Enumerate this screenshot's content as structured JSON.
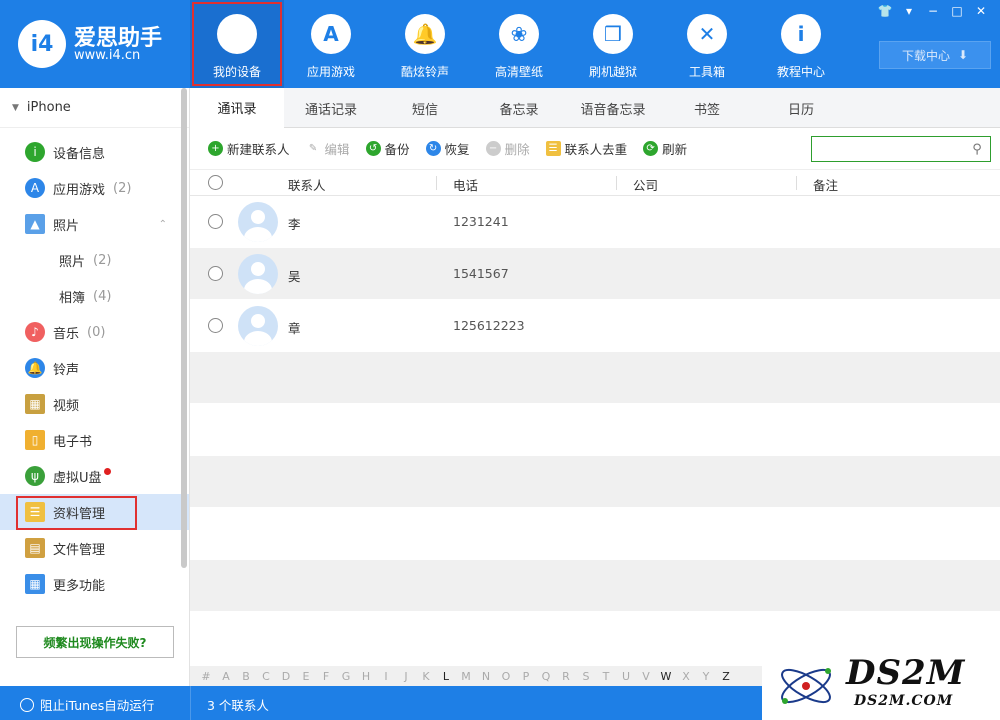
{
  "app": {
    "name": "爱思助手",
    "url": "www.i4.cn",
    "logo_text": "i4"
  },
  "nav": [
    {
      "label": "我的设备",
      "icon": "apple-icon",
      "glyph": "",
      "active": true
    },
    {
      "label": "应用游戏",
      "icon": "app-store-icon",
      "glyph": "A"
    },
    {
      "label": "酷炫铃声",
      "icon": "bell-icon",
      "glyph": "🔔"
    },
    {
      "label": "高清壁纸",
      "icon": "flower-icon",
      "glyph": "❀"
    },
    {
      "label": "刷机越狱",
      "icon": "box-icon",
      "glyph": "❒"
    },
    {
      "label": "工具箱",
      "icon": "tools-icon",
      "glyph": "✕"
    },
    {
      "label": "教程中心",
      "icon": "info-icon",
      "glyph": "i"
    }
  ],
  "download_center": "下载中心",
  "sidebar": {
    "device": "iPhone",
    "items": [
      {
        "label": "设备信息",
        "count": "",
        "icon": "info-circle-icon",
        "color": "#2ea62e",
        "glyph": "i"
      },
      {
        "label": "应用游戏",
        "count": "(2)",
        "icon": "app-store-icon",
        "color": "#2d86e8",
        "glyph": "A"
      },
      {
        "label": "照片",
        "count": "",
        "icon": "photo-icon",
        "color": "#5aa0e8",
        "glyph": "▲"
      },
      {
        "label": "照片",
        "count": "(2)",
        "sub": true
      },
      {
        "label": "相簿",
        "count": "(4)",
        "sub": true
      },
      {
        "label": "音乐",
        "count": "(0)",
        "icon": "music-icon",
        "color": "#f06060",
        "glyph": "♪"
      },
      {
        "label": "铃声",
        "count": "",
        "icon": "bell-icon",
        "color": "#2d86e8",
        "glyph": "🔔"
      },
      {
        "label": "视频",
        "count": "",
        "icon": "film-icon",
        "color": "#c8a040",
        "glyph": "▦"
      },
      {
        "label": "电子书",
        "count": "",
        "icon": "book-icon",
        "color": "#f0b030",
        "glyph": "▯"
      },
      {
        "label": "虚拟U盘",
        "count": "",
        "icon": "usb-icon",
        "color": "#3aa03a",
        "glyph": "ψ"
      },
      {
        "label": "资料管理",
        "count": "",
        "icon": "contacts-icon",
        "color": "#f0c040",
        "glyph": "☰"
      },
      {
        "label": "文件管理",
        "count": "",
        "icon": "file-icon",
        "color": "#d0a040",
        "glyph": "▤"
      },
      {
        "label": "更多功能",
        "count": "",
        "icon": "grid-icon",
        "color": "#3a8ee8",
        "glyph": "▦"
      }
    ],
    "fail_button": "频繁出现操作失败?"
  },
  "tabs": [
    "通讯录",
    "通话记录",
    "短信",
    "备忘录",
    "语音备忘录",
    "书签",
    "日历"
  ],
  "toolbar": {
    "new_contact": "新建联系人",
    "edit": "编辑",
    "backup": "备份",
    "restore": "恢复",
    "delete": "删除",
    "dedupe": "联系人去重",
    "refresh": "刷新"
  },
  "search": {
    "placeholder": ""
  },
  "table": {
    "headers": [
      "联系人",
      "电话",
      "公司",
      "备注"
    ],
    "rows": [
      {
        "name": "李",
        "phone": "1231241"
      },
      {
        "name": "吴",
        "phone": "1541567"
      },
      {
        "name": "章",
        "phone": "125612223"
      }
    ]
  },
  "alphabet": [
    "#",
    "A",
    "B",
    "C",
    "D",
    "E",
    "F",
    "G",
    "H",
    "I",
    "J",
    "K",
    "L",
    "M",
    "N",
    "O",
    "P",
    "Q",
    "R",
    "S",
    "T",
    "U",
    "V",
    "W",
    "X",
    "Y",
    "Z"
  ],
  "alphabet_active": [
    "L",
    "W",
    "Z"
  ],
  "status": {
    "itunes": "阻止iTunes自动运行",
    "count": "3 个联系人"
  },
  "watermark": {
    "big": "DS2M",
    "small": "DS2M.COM"
  }
}
